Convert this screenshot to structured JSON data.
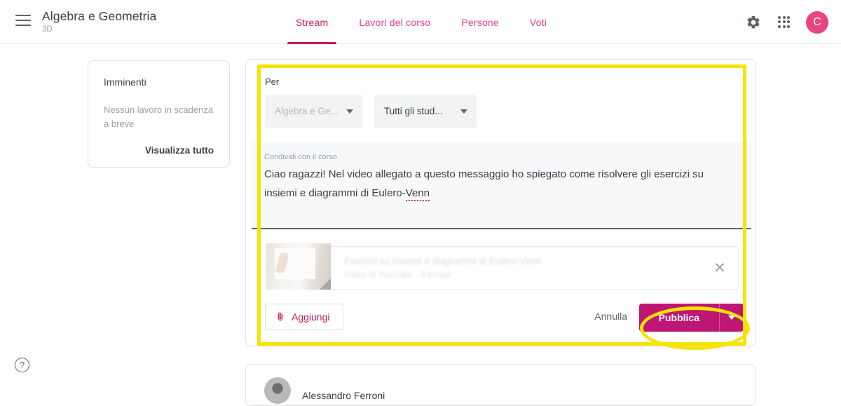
{
  "header": {
    "menu_icon": "hamburger-icon",
    "course_title": "Algebra e Geometria",
    "course_section": "3D",
    "tabs": [
      {
        "label": "Stream",
        "active": true
      },
      {
        "label": "Lavori del corso",
        "active": false
      },
      {
        "label": "Persone",
        "active": false
      },
      {
        "label": "Voti",
        "active": false
      }
    ],
    "settings_icon": "gear-icon",
    "apps_icon": "apps-grid-icon",
    "avatar_initial": "C",
    "accent_color": "#c2185b",
    "avatar_color": "#e8447f"
  },
  "sidebar": {
    "upcoming_title": "Imminenti",
    "upcoming_empty": "Nessun lavoro in scadenza a breve",
    "view_all": "Visualizza tutto"
  },
  "composer": {
    "audience_label": "Per",
    "course_dropdown": "Algebra e Ge...",
    "students_dropdown": "Tutti gli stud...",
    "message_label": "Condividi con il corso",
    "message_text_part1": "Ciao ragazzi! Nel video allegato a questo messaggio ho spiegato come risolvere gli esercizi su insiemi e diagrammi di Eulero-",
    "message_text_misspelled": "Venn",
    "attachment": {
      "title": "Esercizi su insiemi e diagrammi di Eulero-Venn",
      "subtitle": "Video di YouTube · 9 minuti",
      "remove_icon": "close-icon"
    },
    "add_button": "Aggiungi",
    "add_icon": "paperclip-icon",
    "cancel_button": "Annulla",
    "publish_button": "Pubblica",
    "publish_dropdown_icon": "chevron-down-icon",
    "publish_color": "#be1675",
    "highlight_color": "#f5e400"
  },
  "feed": {
    "post_author": "Alessandro Ferroni"
  },
  "footer": {
    "help_icon": "help-circle-icon",
    "help_label": "?"
  }
}
